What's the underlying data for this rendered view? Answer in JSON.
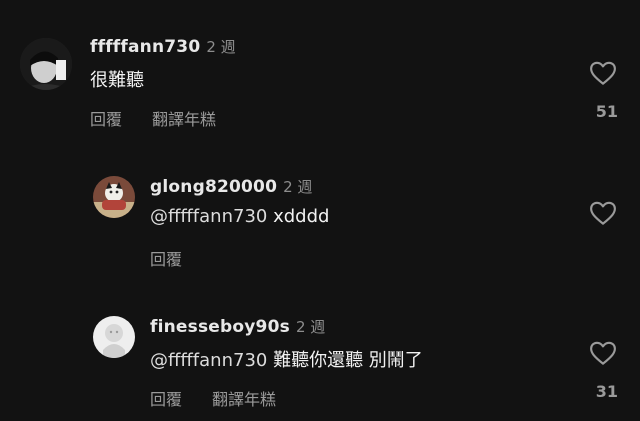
{
  "comments": [
    {
      "username": "fffffann730",
      "time": "2 週",
      "text": "很難聽",
      "reply_label": "回覆",
      "translate_label": "翻譯年糕",
      "likes": "51"
    },
    {
      "username": "glong820000",
      "time": "2 週",
      "mention": "@fffffann730",
      "text": "xdddd",
      "reply_label": "回覆"
    },
    {
      "username": "finesseboy90s",
      "time": "2 週",
      "mention": "@fffffann730",
      "text": "難聽你還聽 別鬧了",
      "reply_label": "回覆",
      "translate_label": "翻譯年糕",
      "likes": "31"
    }
  ],
  "colors": {
    "background": "#121212",
    "secondary_text": "#9a9a9a"
  },
  "icons": {
    "like": "heart-outline-icon"
  }
}
